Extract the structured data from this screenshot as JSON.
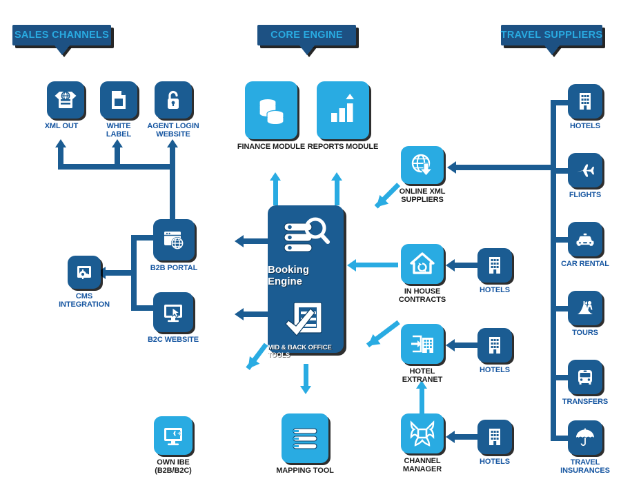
{
  "diagram": {
    "title": "Travel Technology Platform Architecture",
    "colors": {
      "dark_blue": "#1b5c92",
      "light_blue": "#29abe2",
      "banner_bg": "#1d5183",
      "banner_text": "#29abe2",
      "caption_blue": "#1555a0",
      "caption_black": "#1a1a1a",
      "background": "#ffffff"
    }
  },
  "banners": [
    {
      "id": "sales-channels",
      "label": "SALES CHANNELS"
    },
    {
      "id": "core-engine",
      "label": "CORE ENGINE"
    },
    {
      "id": "travel-suppliers",
      "label": "TRAVEL SUPPLIERS"
    }
  ],
  "sales_channels": {
    "top_row": [
      {
        "id": "xml-out",
        "label": "XML OUT",
        "icon": "xml-document-icon",
        "style": "dark"
      },
      {
        "id": "white-label",
        "label": "WHITE LABEL",
        "icon": "page-document-icon",
        "style": "dark"
      },
      {
        "id": "agent-login-website",
        "label": "AGENT LOGIN\nWEBSITE",
        "icon": "padlock-icon",
        "style": "dark"
      }
    ],
    "portals": [
      {
        "id": "b2b-portal",
        "label": "B2B PORTAL",
        "icon": "browser-globe-icon",
        "style": "dark"
      },
      {
        "id": "b2c-website",
        "label": "B2C WEBSITE",
        "icon": "monitor-cursor-icon",
        "style": "dark"
      },
      {
        "id": "cms-integration",
        "label": "CMS\nINTEGRATION",
        "icon": "cms-gear-icon",
        "style": "dark"
      }
    ],
    "own_ibe": {
      "id": "own-ibe",
      "label": "OWN IBE\n(B2B/B2C)",
      "icon": "monitor-plane-icon",
      "style": "light"
    }
  },
  "core_engine": {
    "modules": [
      {
        "id": "finance-module",
        "label": "FINANCE MODULE",
        "icon": "coins-stack-icon",
        "style": "light"
      },
      {
        "id": "reports-module",
        "label": "REPORTS MODULE",
        "icon": "bar-chart-arrow-icon",
        "style": "light"
      }
    ],
    "main_panel": {
      "id": "booking-engine-panel",
      "booking_engine_label": "Booking Engine",
      "booking_engine_icon": "server-search-icon",
      "back_office_label": "MID & BACK OFFICE TOOLS",
      "back_office_icon": "checklist-document-icon"
    },
    "mapping_tool": {
      "id": "mapping-tool",
      "label": "MAPPING TOOL",
      "icon": "list-rows-icon",
      "style": "light"
    }
  },
  "connectivity": [
    {
      "id": "online-xml-suppliers",
      "label": "ONLINE XML\nSUPPLIERS",
      "icon": "globe-download-icon",
      "style": "light"
    },
    {
      "id": "in-house-contracts",
      "label": "IN HOUSE\nCONTRACTS",
      "icon": "house-refresh-icon",
      "style": "light"
    },
    {
      "id": "hotel-extranet",
      "label": "HOTEL\nEXTRANET",
      "icon": "building-login-icon",
      "style": "light"
    },
    {
      "id": "channel-manager",
      "label": "CHANNEL\nMANAGER",
      "icon": "channel-network-icon",
      "style": "light"
    }
  ],
  "hotel_feeds": [
    {
      "id": "hotels-in-house",
      "label": "HOTELS",
      "icon": "building-icon",
      "style": "dark"
    },
    {
      "id": "hotels-extranet",
      "label": "HOTELS",
      "icon": "building-icon",
      "style": "dark"
    },
    {
      "id": "hotels-channel-manager",
      "label": "HOTELS",
      "icon": "building-icon",
      "style": "dark"
    }
  ],
  "travel_suppliers": [
    {
      "id": "hotels",
      "label": "HOTELS",
      "icon": "building-icon",
      "style": "dark"
    },
    {
      "id": "flights",
      "label": "FLIGHTS",
      "icon": "airplane-icon",
      "style": "dark"
    },
    {
      "id": "car-rental",
      "label": "CAR RENTAL",
      "icon": "car-icon",
      "style": "dark"
    },
    {
      "id": "tours",
      "label": "TOURS",
      "icon": "tours-landmark-icon",
      "style": "dark"
    },
    {
      "id": "transfers",
      "label": "TRANSFERS",
      "icon": "bus-icon",
      "style": "dark"
    },
    {
      "id": "travel-insurances",
      "label": "TRAVEL\nINSURANCES",
      "icon": "umbrella-icon",
      "style": "dark"
    }
  ]
}
